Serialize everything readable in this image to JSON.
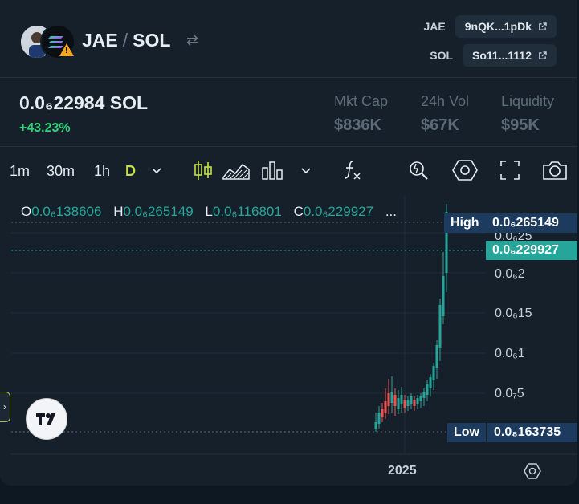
{
  "header": {
    "base_symbol": "JAE",
    "quote_symbol": "SOL",
    "separator": "/",
    "addresses": [
      {
        "label": "JAE",
        "value": "9nQK...1pDk"
      },
      {
        "label": "SOL",
        "value": "So11...1112"
      }
    ]
  },
  "stats": {
    "price": "0.0₆22984 SOL",
    "change": "+43.23%",
    "items": [
      {
        "label": "Mkt Cap",
        "value": "$836K"
      },
      {
        "label": "24h Vol",
        "value": "$67K"
      },
      {
        "label": "Liquidity",
        "value": "$95K"
      }
    ]
  },
  "toolbar": {
    "timeframes": [
      "1m",
      "30m",
      "1h",
      "D"
    ],
    "active_timeframe": "D"
  },
  "ohlc": {
    "o_label": "O",
    "o": "0.0₆138606",
    "h_label": "H",
    "h": "0.0₆265149",
    "l_label": "L",
    "l": "0.0₆116801",
    "c_label": "C",
    "c": "0.0₆229927",
    "more": "..."
  },
  "price_axis": {
    "ticks": [
      "0.0₆25",
      "0.0₆2",
      "0.0₆15",
      "0.0₆1",
      "0.0₇5"
    ],
    "high_label": "High",
    "high_value": "0.0₆265149",
    "current_value": "0.0₆229927",
    "low_label": "Low",
    "low_value": "0.0₈163735"
  },
  "time_axis": {
    "label": "2025"
  },
  "colors": {
    "up": "#26a69a",
    "down": "#ef5350",
    "accent": "#c8e04a",
    "positive": "#2fd37a"
  }
}
